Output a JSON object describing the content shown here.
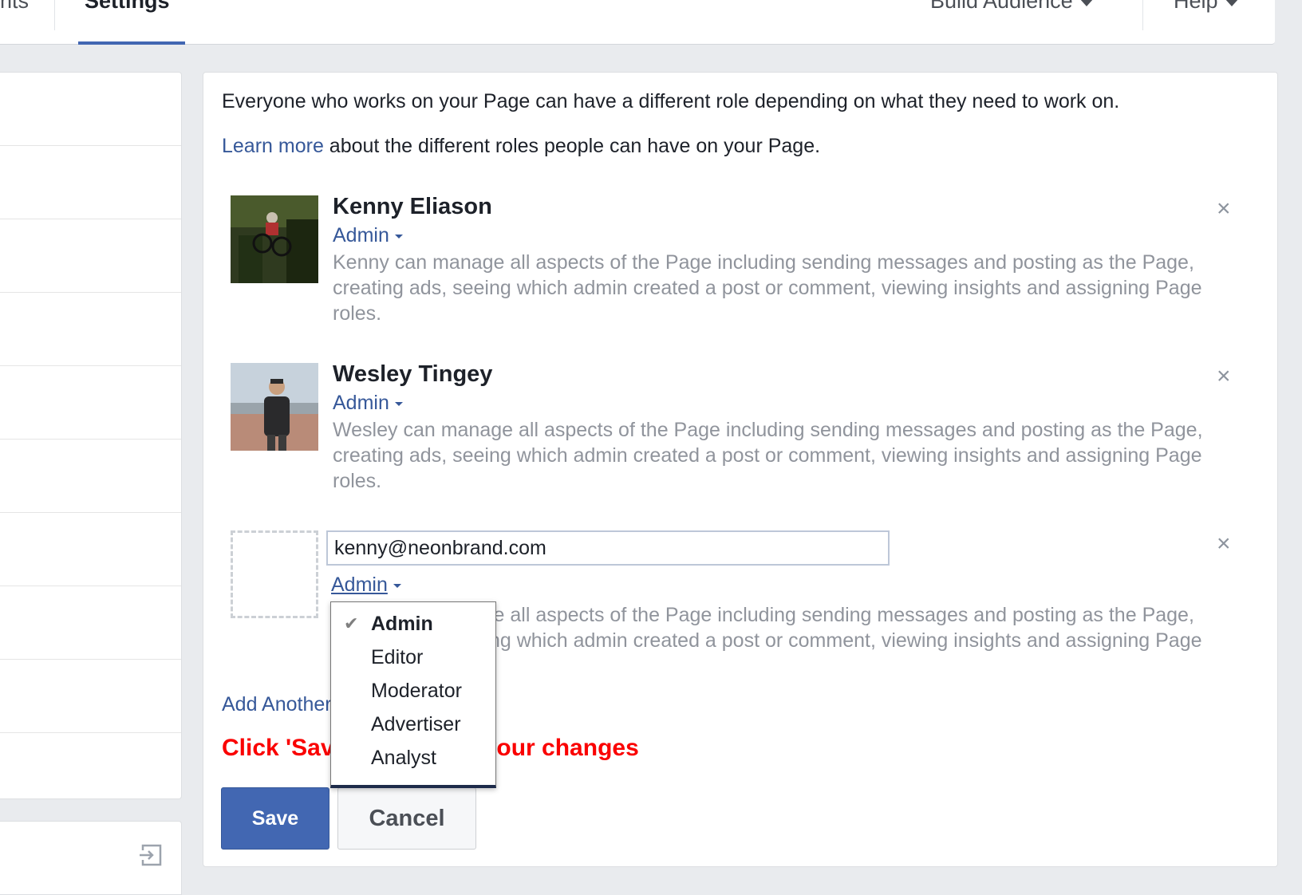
{
  "topnav": {
    "prev_tab": "nts",
    "active_tab": "Settings",
    "build_audience": "Build Audience",
    "help": "Help"
  },
  "intro": "Everyone who works on your Page can have a different role depending on what they need to work on.",
  "learn_more": {
    "link": "Learn more",
    "rest": " about the different roles people can have on your Page."
  },
  "people": [
    {
      "name": "Kenny Eliason",
      "role": "Admin",
      "description": "Kenny can manage all aspects of the Page including sending messages and posting as the Page, creating ads, seeing which admin created a post or comment, viewing insights and assigning Page roles."
    },
    {
      "name": "Wesley Tingey",
      "role": "Admin",
      "description": "Wesley can manage all aspects of the Page including sending messages and posting as the Page, creating ads, seeing which admin created a post or comment, viewing insights and assigning Page roles."
    }
  ],
  "new_person": {
    "email_value": "kenny@neonbrand.com",
    "role": "Admin",
    "description": "Kenny can manage all aspects of the Page including sending messages and posting as the Page, creating ads, seeing which admin created a post or comment, viewing insights and assigning Page roles."
  },
  "close_glyph": "×",
  "add_another": "Add Another Person",
  "notice": "Click 'Save' to confirm your changes",
  "buttons": {
    "save": "Save",
    "cancel": "Cancel"
  },
  "role_menu": {
    "selected": "Admin",
    "options": [
      "Admin",
      "Editor",
      "Moderator",
      "Advertiser",
      "Analyst"
    ]
  },
  "colors": {
    "link": "#365899",
    "primary_button": "#4267b2",
    "notice": "#fa0000",
    "muted_text": "#90949c"
  }
}
